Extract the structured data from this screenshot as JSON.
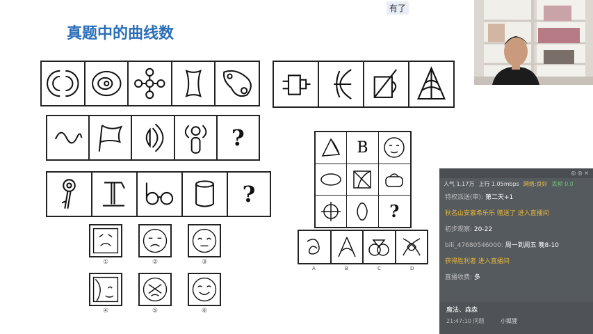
{
  "slide": {
    "title": "真题中的曲线数",
    "question_mark": "?",
    "letter_b": "B",
    "option_labels": [
      "A",
      "B",
      "C",
      "D"
    ],
    "face_numbers": [
      "①",
      "②",
      "③",
      "④",
      "⑤",
      "⑥"
    ]
  },
  "overlay": {
    "badge": "有了"
  },
  "chat": {
    "topbar": "◎ ◎ ×",
    "stats": {
      "popularity": "人气 1.17万",
      "upload": "上行 1.05mbps",
      "network": "网络:良好",
      "lag": "丢帧 0.0"
    },
    "messages": [
      {
        "user": "特权派送(审):",
        "text": "第二天+1"
      },
      {
        "user": "",
        "sys": "秋名山安慕希乐乐 赠送了 进入直播间",
        "text": ""
      },
      {
        "user": "初步观察:",
        "text": "20-22"
      },
      {
        "user": "bili_47680546000:",
        "text": "周一到周五 晚8-10"
      },
      {
        "user": "",
        "sys": "获得胜利者 进入直播间",
        "text": ""
      },
      {
        "user": "直播收费:",
        "text": "多"
      }
    ],
    "footer": {
      "line1": "魔法、森森",
      "time": "21:47:10 问题",
      "sender": "小狐狸"
    }
  },
  "colors": {
    "title": "#2a6db8",
    "chat_bg": "#555a5e",
    "system_msg": "#e6b43c"
  }
}
